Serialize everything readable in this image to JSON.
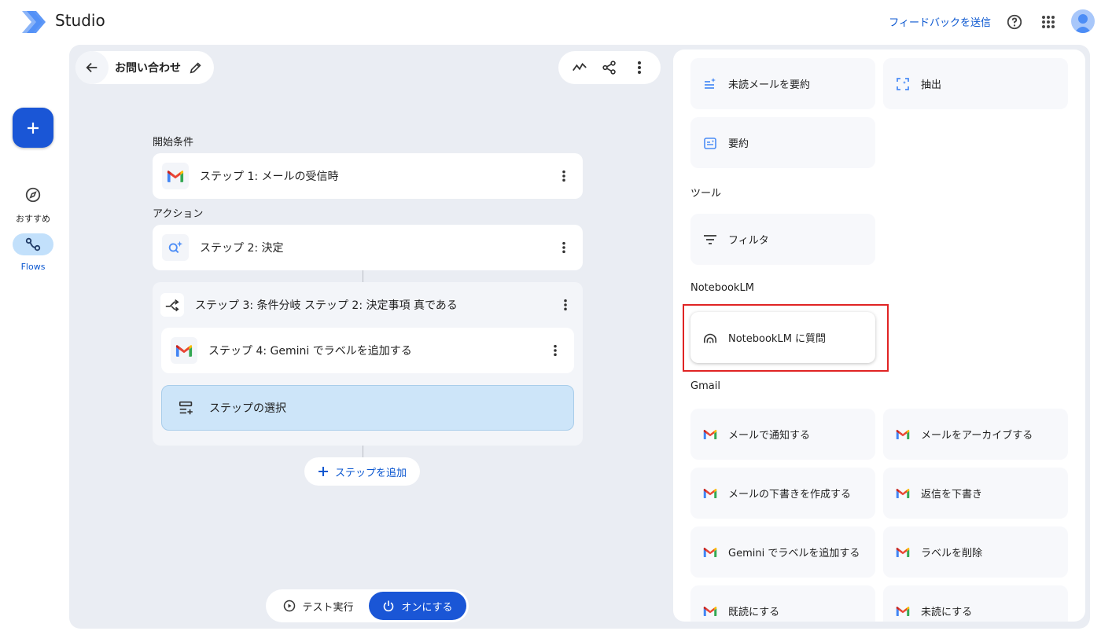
{
  "header": {
    "app_title": "Studio",
    "feedback_label": "フィードバックを送信"
  },
  "rail": {
    "items": [
      {
        "label": "おすすめ",
        "icon": "compass-icon"
      },
      {
        "label": "Flows",
        "icon": "flows-icon",
        "active": true
      }
    ]
  },
  "canvas": {
    "flow_name": "お問い合わせ",
    "trigger_section_label": "開始条件",
    "action_section_label": "アクション",
    "steps": [
      {
        "label": "ステップ 1: メールの受信時",
        "icon": "gmail-icon"
      },
      {
        "label": "ステップ 2: 決定",
        "icon": "gemini-decide-icon"
      },
      {
        "label": "ステップ 3: 条件分岐 ステップ 2: 決定事項 真である",
        "icon": "branch-icon"
      },
      {
        "label": "ステップ 4: Gemini でラベルを追加する",
        "icon": "gmail-icon"
      }
    ],
    "select_step_label": "ステップの選択",
    "add_step_label": "ステップを追加",
    "test_run_label": "テスト実行",
    "turn_on_label": "オンにする"
  },
  "panel": {
    "top_tiles": [
      {
        "label": "未読メールを要約",
        "icon": "summarize-unread-icon"
      },
      {
        "label": "抽出",
        "icon": "extract-icon"
      },
      {
        "label": "要約",
        "icon": "summarize-icon"
      }
    ],
    "tools_heading": "ツール",
    "tools": [
      {
        "label": "フィルタ",
        "icon": "filter-icon"
      }
    ],
    "notebooklm_heading": "NotebookLM",
    "notebooklm": [
      {
        "label": "NotebookLM に質問",
        "icon": "notebooklm-icon"
      }
    ],
    "gmail_heading": "Gmail",
    "gmail": [
      {
        "label": "メールで通知する",
        "icon": "gmail-icon"
      },
      {
        "label": "メールをアーカイブする",
        "icon": "gmail-icon"
      },
      {
        "label": "メールの下書きを作成する",
        "icon": "gmail-icon"
      },
      {
        "label": "返信を下書き",
        "icon": "gmail-icon"
      },
      {
        "label": "Gemini でラベルを追加する",
        "icon": "gmail-icon"
      },
      {
        "label": "ラベルを削除",
        "icon": "gmail-icon"
      },
      {
        "label": "既読にする",
        "icon": "gmail-icon"
      },
      {
        "label": "未読にする",
        "icon": "gmail-icon"
      }
    ]
  },
  "colors": {
    "accent": "#1a56d6",
    "link": "#0b57d0",
    "canvas_bg": "#eaedf3",
    "selected_step_bg": "#cde5f9",
    "highlight": "#e02424"
  }
}
